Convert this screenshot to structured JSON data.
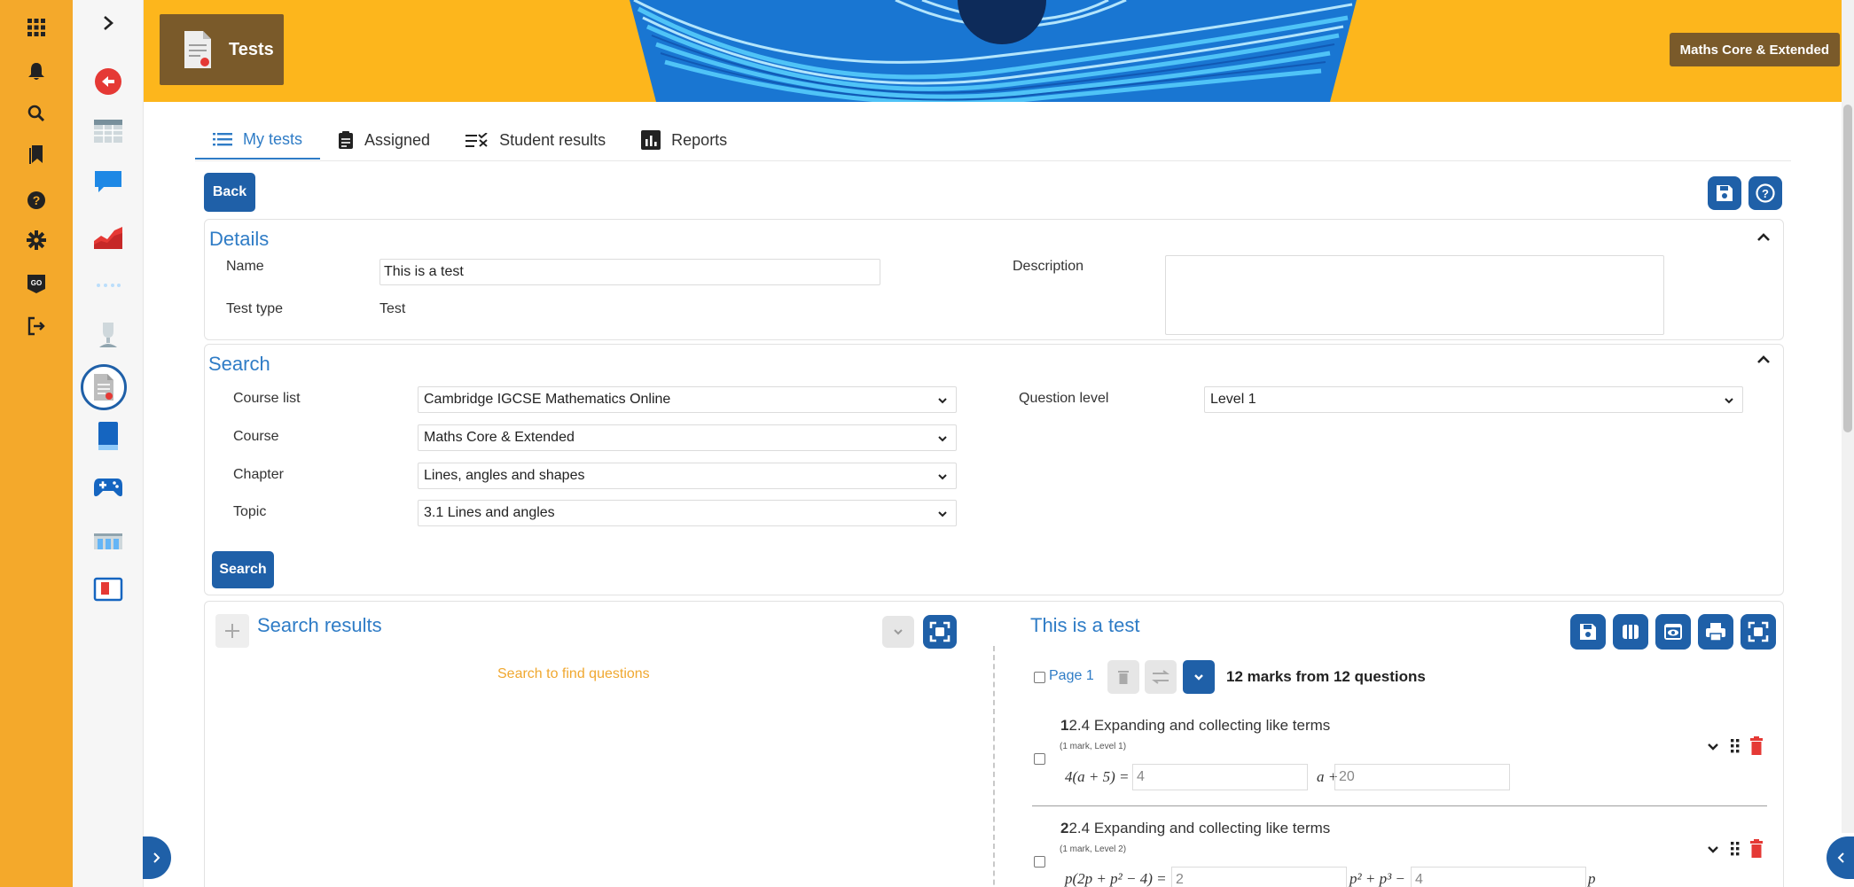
{
  "header": {
    "title": "Tests",
    "course_badge": "Maths Core & Extended"
  },
  "rail_icons": [
    "apps-grid-icon",
    "bell-icon",
    "search-icon",
    "bookmark-icon",
    "help-icon",
    "settings-icon",
    "go-icon",
    "logout-icon"
  ],
  "sidebar_icons": [
    "expand-chevron-icon",
    "back-circle-icon",
    "table-icon",
    "chat-icon",
    "chart-icon",
    "dots-icon",
    "trophy-icon",
    "tests-doc-icon",
    "book-icon",
    "gamepad-icon",
    "classroom-icon",
    "flashcard-icon"
  ],
  "tabs": [
    {
      "label": "My tests"
    },
    {
      "label": "Assigned"
    },
    {
      "label": "Student results"
    },
    {
      "label": "Reports"
    }
  ],
  "back_label": "Back",
  "details": {
    "title": "Details",
    "name_label": "Name",
    "name_value": "This is a test",
    "type_label": "Test type",
    "type_value": "Test",
    "description_label": "Description",
    "description_value": ""
  },
  "search": {
    "title": "Search",
    "course_list_label": "Course list",
    "course_list_value": "Cambridge IGCSE Mathematics Online",
    "course_label": "Course",
    "course_value": "Maths Core & Extended",
    "chapter_label": "Chapter",
    "chapter_value": "Lines, angles and shapes",
    "topic_label": "Topic",
    "topic_value": "3.1 Lines and angles",
    "level_label": "Question level",
    "level_value": "Level 1",
    "button_label": "Search"
  },
  "results": {
    "title": "Search results",
    "empty_text": "Search to find questions"
  },
  "test": {
    "title": "This is a test",
    "page_label": "Page 1",
    "summary": "12 marks from 12 questions",
    "questions": [
      {
        "num": "1",
        "title": "2.4 Expanding and collecting like terms",
        "meta": "(1 mark, Level 1)",
        "lhs": "4(a + 5) =",
        "ans1": "4",
        "mid": "a +",
        "ans2": "20"
      },
      {
        "num": "2",
        "title": "2.4 Expanding and collecting like terms",
        "meta": "(1 mark, Level 2)",
        "lhs": "p(2p + p² − 4) =",
        "ans1": "2",
        "mid": "p² + p³ −",
        "ans2": "4",
        "tail": "p"
      }
    ]
  },
  "colors": {
    "rail": "#f4a92b",
    "header": "#fdb61c",
    "accent_blue": "#1f60a8",
    "link_blue": "#2f7cc6",
    "empty_orange": "#f0a830",
    "delete_red": "#e53935"
  }
}
